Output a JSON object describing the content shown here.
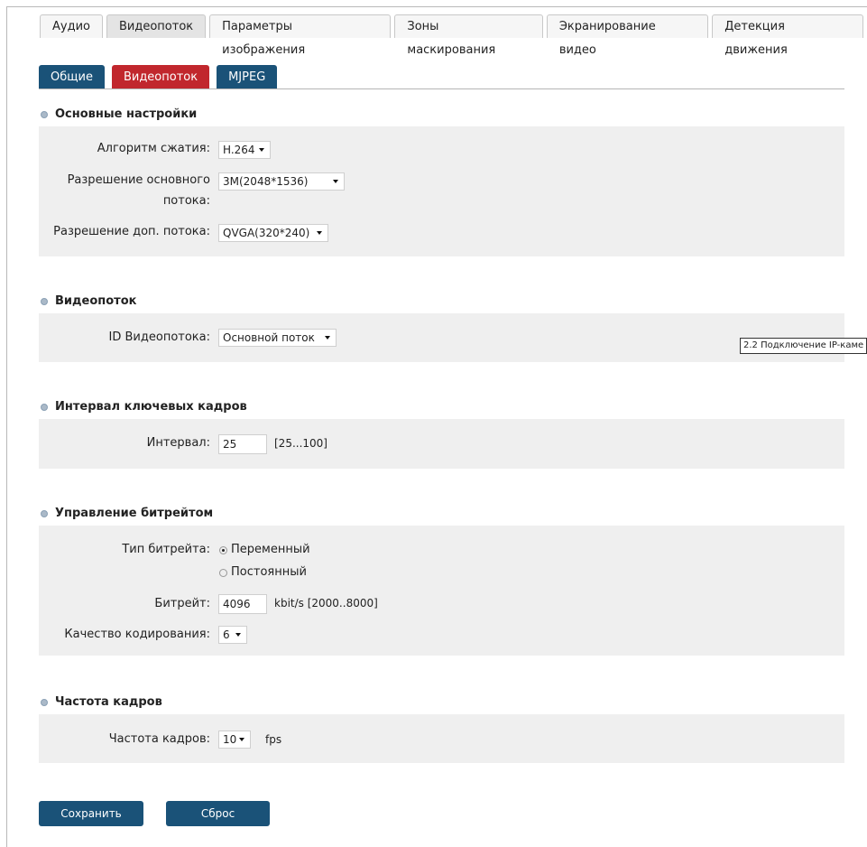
{
  "top_tabs": [
    "Аудио",
    "Видеопоток",
    "Параметры изображения",
    "Зоны маскирования",
    "Экранирование видео",
    "Детекция движения"
  ],
  "sub_tabs": [
    "Общие",
    "Видеопоток",
    "MJPEG"
  ],
  "sections": {
    "basic": {
      "title": "Основные настройки",
      "compression_label": "Алгоритм сжатия:",
      "compression_value": "H.264",
      "main_res_label_line1": "Разрешение основного",
      "main_res_label_line2": "потока:",
      "main_res_value": "3M(2048*1536)",
      "sub_res_label": "Разрешение доп. потока:",
      "sub_res_value": "QVGA(320*240)"
    },
    "stream": {
      "title": "Видеопоток",
      "id_label": "ID Видеопотока:",
      "id_value": "Основной поток"
    },
    "keyframe": {
      "title": "Интервал ключевых кадров",
      "interval_label": "Интервал:",
      "interval_value": "25",
      "interval_range": "[25...100]"
    },
    "bitrate": {
      "title": "Управление битрейтом",
      "type_label": "Тип битрейта:",
      "type_variable": "Переменный",
      "type_constant": "Постоянный",
      "bitrate_label": "Битрейт:",
      "bitrate_value": "4096",
      "bitrate_unit": "kbit/s  [2000..8000]",
      "quality_label": "Качество кодирования:",
      "quality_value": "6"
    },
    "framerate": {
      "title": "Частота кадров",
      "fps_label": "Частота кадров:",
      "fps_value": "10",
      "fps_unit": "fps"
    }
  },
  "buttons": {
    "save": "Сохранить",
    "reset": "Сброс"
  },
  "tooltip": "2.2  Подключение IP-каме",
  "colors": {
    "primary": "#1a5278",
    "active_tab": "#c1272d",
    "panel": "#efefef"
  }
}
